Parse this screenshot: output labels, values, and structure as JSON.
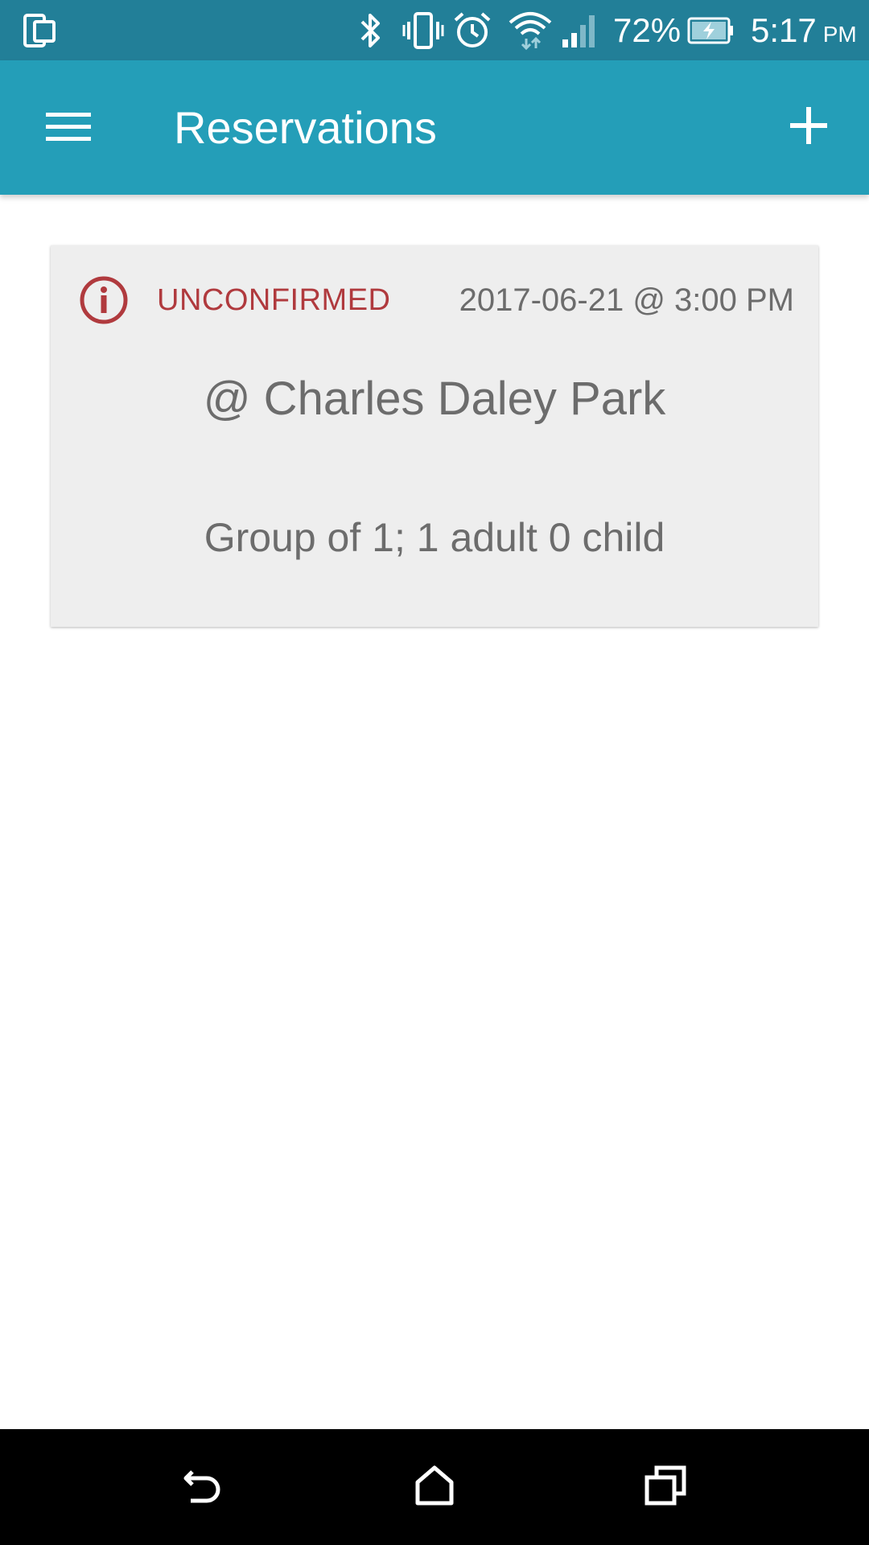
{
  "status_bar": {
    "battery_percent": "72%",
    "time": "5:17",
    "ampm": "PM",
    "icons": [
      "phone-tablet-icon",
      "bluetooth-icon",
      "vibrate-icon",
      "alarm-icon",
      "wifi-icon",
      "cell-signal-icon",
      "battery-charging-icon"
    ]
  },
  "app_bar": {
    "title": "Reservations",
    "menu_icon": "hamburger-menu-icon",
    "add_icon": "plus-icon",
    "color": "#249eb8"
  },
  "reservations": [
    {
      "status": "UNCONFIRMED",
      "status_icon": "info-circle-icon",
      "status_color": "#b03a3e",
      "datetime": "2017-06-21 @ 3:00 PM",
      "location": "@ Charles Daley Park",
      "group": "Group of 1; 1 adult 0 child"
    }
  ],
  "nav_bar": {
    "icons": [
      "back-icon",
      "home-icon",
      "recents-icon"
    ]
  }
}
